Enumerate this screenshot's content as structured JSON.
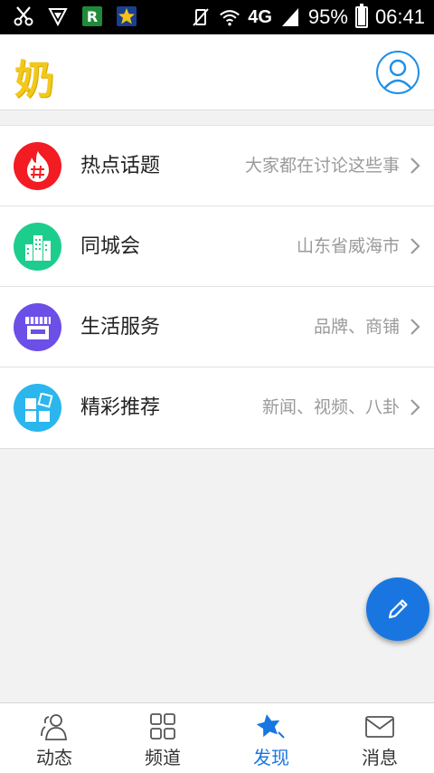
{
  "status_bar": {
    "icons": [
      "scissors-icon",
      "shield-icon",
      "r-app-icon",
      "star-app-icon"
    ],
    "network": "4G",
    "battery": "95%",
    "battery_level": 0.95,
    "time": "06:41"
  },
  "header": {
    "logo_text": "奶",
    "logo_color": "#f2c81a",
    "profile_icon": "user-icon"
  },
  "list": {
    "items": [
      {
        "label": "热点话题",
        "subtitle": "大家都在讨论这些事",
        "icon": "hot-topic-icon",
        "color": "#f21c22"
      },
      {
        "label": "同城会",
        "subtitle": "山东省威海市",
        "icon": "city-icon",
        "color": "#1dcd8e"
      },
      {
        "label": "生活服务",
        "subtitle": "品牌、商铺",
        "icon": "store-icon",
        "color": "#6b4fe6"
      },
      {
        "label": "精彩推荐",
        "subtitle": "新闻、视频、八卦",
        "icon": "recommend-icon",
        "color": "#2bb6ee"
      }
    ]
  },
  "fab": {
    "icon": "pencil-icon",
    "color": "#1976e0"
  },
  "bottom_nav": {
    "items": [
      {
        "label": "动态",
        "icon": "friends-icon"
      },
      {
        "label": "频道",
        "icon": "grid-icon"
      },
      {
        "label": "发现",
        "icon": "star-icon"
      },
      {
        "label": "消息",
        "icon": "mail-icon"
      }
    ],
    "active_index": 2,
    "active_color": "#1976e0"
  }
}
